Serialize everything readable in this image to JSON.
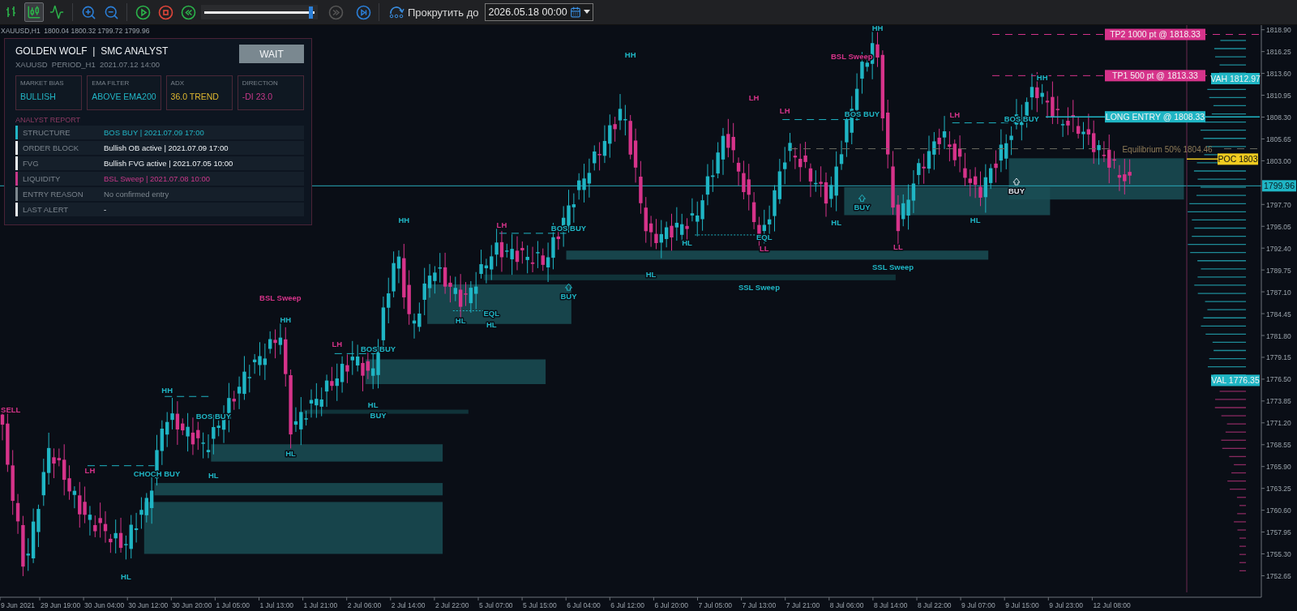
{
  "toolbar": {
    "chart_types": [
      {
        "kind": "bars",
        "selected": false
      },
      {
        "kind": "candles",
        "selected": true
      },
      {
        "kind": "line",
        "selected": false
      }
    ],
    "tools": [
      {
        "kind": "zoom-in",
        "disabled": false
      },
      {
        "kind": "zoom-out",
        "disabled": false
      },
      {
        "kind": "play",
        "disabled": false
      },
      {
        "kind": "stop",
        "disabled": false
      },
      {
        "kind": "rewind",
        "disabled": false
      }
    ],
    "playback": {
      "level": 0.97
    },
    "step_tools": [
      {
        "kind": "fast-forward",
        "disabled": true
      },
      {
        "kind": "step",
        "disabled": false
      }
    ],
    "scroll_label": "Прокрутить до",
    "date": "2026.05.18 00:00"
  },
  "chart": {
    "symbol_line": "XAUUSD,H1  1800.04 1800.32 1799.72 1799.96",
    "price_ticks": [
      "1818.90",
      "1816.25",
      "1813.60",
      "1810.95",
      "1808.30",
      "1805.65",
      "1803.00",
      "1797.70",
      "1795.05",
      "1792.40",
      "1789.75",
      "1787.10",
      "1784.45",
      "1781.80",
      "1779.15",
      "1776.50",
      "1773.85",
      "1771.20",
      "1768.55",
      "1765.90",
      "1763.25",
      "1760.60",
      "1757.95",
      "1755.30",
      "1752.65"
    ],
    "current_price": "1799.96",
    "time_labels": [
      "9 Jun 2021",
      "29 Jun 19:00",
      "30 Jun 04:00",
      "30 Jun 12:00",
      "30 Jun 20:00",
      "1 Jul 05:00",
      "1 Jul 13:00",
      "1 Jul 21:00",
      "2 Jul 06:00",
      "2 Jul 14:00",
      "2 Jul 22:00",
      "5 Jul 07:00",
      "5 Jul 15:00",
      "6 Jul 04:00",
      "6 Jul 12:00",
      "6 Jul 20:00",
      "7 Jul 05:00",
      "7 Jul 13:00",
      "7 Jul 21:00",
      "8 Jul 06:00",
      "8 Jul 14:00",
      "8 Jul 22:00",
      "9 Jul 07:00",
      "9 Jul 15:00",
      "9 Jul 23:00",
      "12 Jul 08:00"
    ],
    "levels": [
      {
        "kind": "tp",
        "label": "TP2  1000 pt  @ 1818.33"
      },
      {
        "kind": "tp",
        "label": "TP1  500 pt  @ 1813.33"
      },
      {
        "kind": "value-area",
        "label": "VAH 1812.97"
      },
      {
        "kind": "entry",
        "label": "LONG ENTRY  @ 1808.33"
      },
      {
        "kind": "equilibrium",
        "label": "Equilibrium 50%  1804.46"
      },
      {
        "kind": "poc",
        "label": "POC 1803"
      },
      {
        "kind": "value-area",
        "label": "VAL 1776.35"
      }
    ],
    "annotations": [
      {
        "kind": "label",
        "text": "SELL",
        "color": "#d6338a"
      },
      {
        "kind": "label",
        "text": "LH",
        "color": "#d6338a"
      },
      {
        "kind": "label",
        "text": "CHOCH BUY",
        "color": "#1fb5c4"
      },
      {
        "kind": "label",
        "text": "HL",
        "color": "#1fb5c4"
      },
      {
        "kind": "label",
        "text": "HH",
        "color": "#1fb5c4"
      },
      {
        "kind": "label",
        "text": "BOS BUY",
        "color": "#1fb5c4"
      },
      {
        "kind": "label",
        "text": "HL",
        "color": "#1fb5c4"
      },
      {
        "kind": "label",
        "text": "HL",
        "color": "#1fb5c4"
      },
      {
        "kind": "label",
        "text": "BSL Sweep",
        "color": "#d6338a"
      },
      {
        "kind": "label",
        "text": "HH",
        "color": "#1fb5c4"
      },
      {
        "kind": "label",
        "text": "LH",
        "color": "#d6338a"
      },
      {
        "kind": "label",
        "text": "BOS BUY",
        "color": "#1fb5c4"
      },
      {
        "kind": "label",
        "text": "HL",
        "color": "#1fb5c4"
      },
      {
        "kind": "label",
        "text": "BUY",
        "color": "#1fb5c4"
      },
      {
        "kind": "label",
        "text": "HH",
        "color": "#1fb5c4"
      },
      {
        "kind": "label",
        "text": "HL",
        "color": "#1fb5c4"
      },
      {
        "kind": "label",
        "text": "EQL",
        "color": "#1fb5c4"
      },
      {
        "kind": "label",
        "text": "HL",
        "color": "#1fb5c4"
      },
      {
        "kind": "label",
        "text": "LH",
        "color": "#d6338a"
      },
      {
        "kind": "label",
        "text": "BOS BUY",
        "color": "#1fb5c4"
      },
      {
        "kind": "signal",
        "text": "BUY",
        "color": "#1fb5c4"
      },
      {
        "kind": "label",
        "text": "HH",
        "color": "#1fb5c4"
      },
      {
        "kind": "label",
        "text": "HL",
        "color": "#1fb5c4"
      },
      {
        "kind": "label",
        "text": "HL",
        "color": "#1fb5c4"
      },
      {
        "kind": "label",
        "text": "LH",
        "color": "#d6338a"
      },
      {
        "kind": "label",
        "text": "EQL",
        "color": "#1fb5c4"
      },
      {
        "kind": "label",
        "text": "LL",
        "color": "#d6338a"
      },
      {
        "kind": "label",
        "text": "LH",
        "color": "#d6338a"
      },
      {
        "kind": "label",
        "text": "SSL Sweep",
        "color": "#1fb5c4"
      },
      {
        "kind": "label",
        "text": "BSL Sweep",
        "color": "#d6338a"
      },
      {
        "kind": "label",
        "text": "HH",
        "color": "#1fb5c4"
      },
      {
        "kind": "label",
        "text": "BOS BUY",
        "color": "#1fb5c4"
      },
      {
        "kind": "label",
        "text": "HL",
        "color": "#1fb5c4"
      },
      {
        "kind": "signal",
        "text": "BUY",
        "color": "#1fb5c4"
      },
      {
        "kind": "label",
        "text": "LL",
        "color": "#d6338a"
      },
      {
        "kind": "label",
        "text": "SSL Sweep",
        "color": "#1fb5c4"
      },
      {
        "kind": "label",
        "text": "LH",
        "color": "#d6338a"
      },
      {
        "kind": "label",
        "text": "HL",
        "color": "#1fb5c4"
      },
      {
        "kind": "label",
        "text": "BOS BUY",
        "color": "#1fb5c4"
      },
      {
        "kind": "label",
        "text": "HH",
        "color": "#1fb5c4"
      },
      {
        "kind": "signal",
        "text": "BUY",
        "color": "#d8e0e6"
      }
    ]
  },
  "panel": {
    "title": "GOLDEN WOLF  |  SMC ANALYST",
    "subtitle": "XAUUSD  PERIOD_H1  2021.07.12 14:00",
    "status_button": "WAIT",
    "cards": [
      {
        "label": "MARKET BIAS",
        "value": "BULLISH",
        "color": "#22b5c5"
      },
      {
        "label": "EMA FILTER",
        "value": "ABOVE EMA200",
        "color": "#22b5c5"
      },
      {
        "label": "ADX",
        "value": "36.0 TREND",
        "color": "#e0b830"
      },
      {
        "label": "DIRECTION",
        "value": "-DI 23.0",
        "color": "#c8388a"
      }
    ],
    "report_title": "ANALYST REPORT",
    "report": [
      {
        "label": "STRUCTURE",
        "value": "BOS BUY | 2021.07.09 17:00",
        "color": "#22b5c5"
      },
      {
        "label": "ORDER BLOCK",
        "value": "Bullish OB active | 2021.07.09 17:00",
        "color": "#eef2f5"
      },
      {
        "label": "FVG",
        "value": "Bullish FVG active | 2021.07.05 10:00",
        "color": "#eef2f5"
      },
      {
        "label": "LIQUIDITY",
        "value": "BSL Sweep | 2021.07.08 10:00",
        "color": "#c8388a"
      },
      {
        "label": "ENTRY REASON",
        "value": "No confirmed entry",
        "color": "#7d878f"
      },
      {
        "label": "LAST ALERT",
        "value": "-",
        "color": "#eef2f5"
      }
    ]
  }
}
